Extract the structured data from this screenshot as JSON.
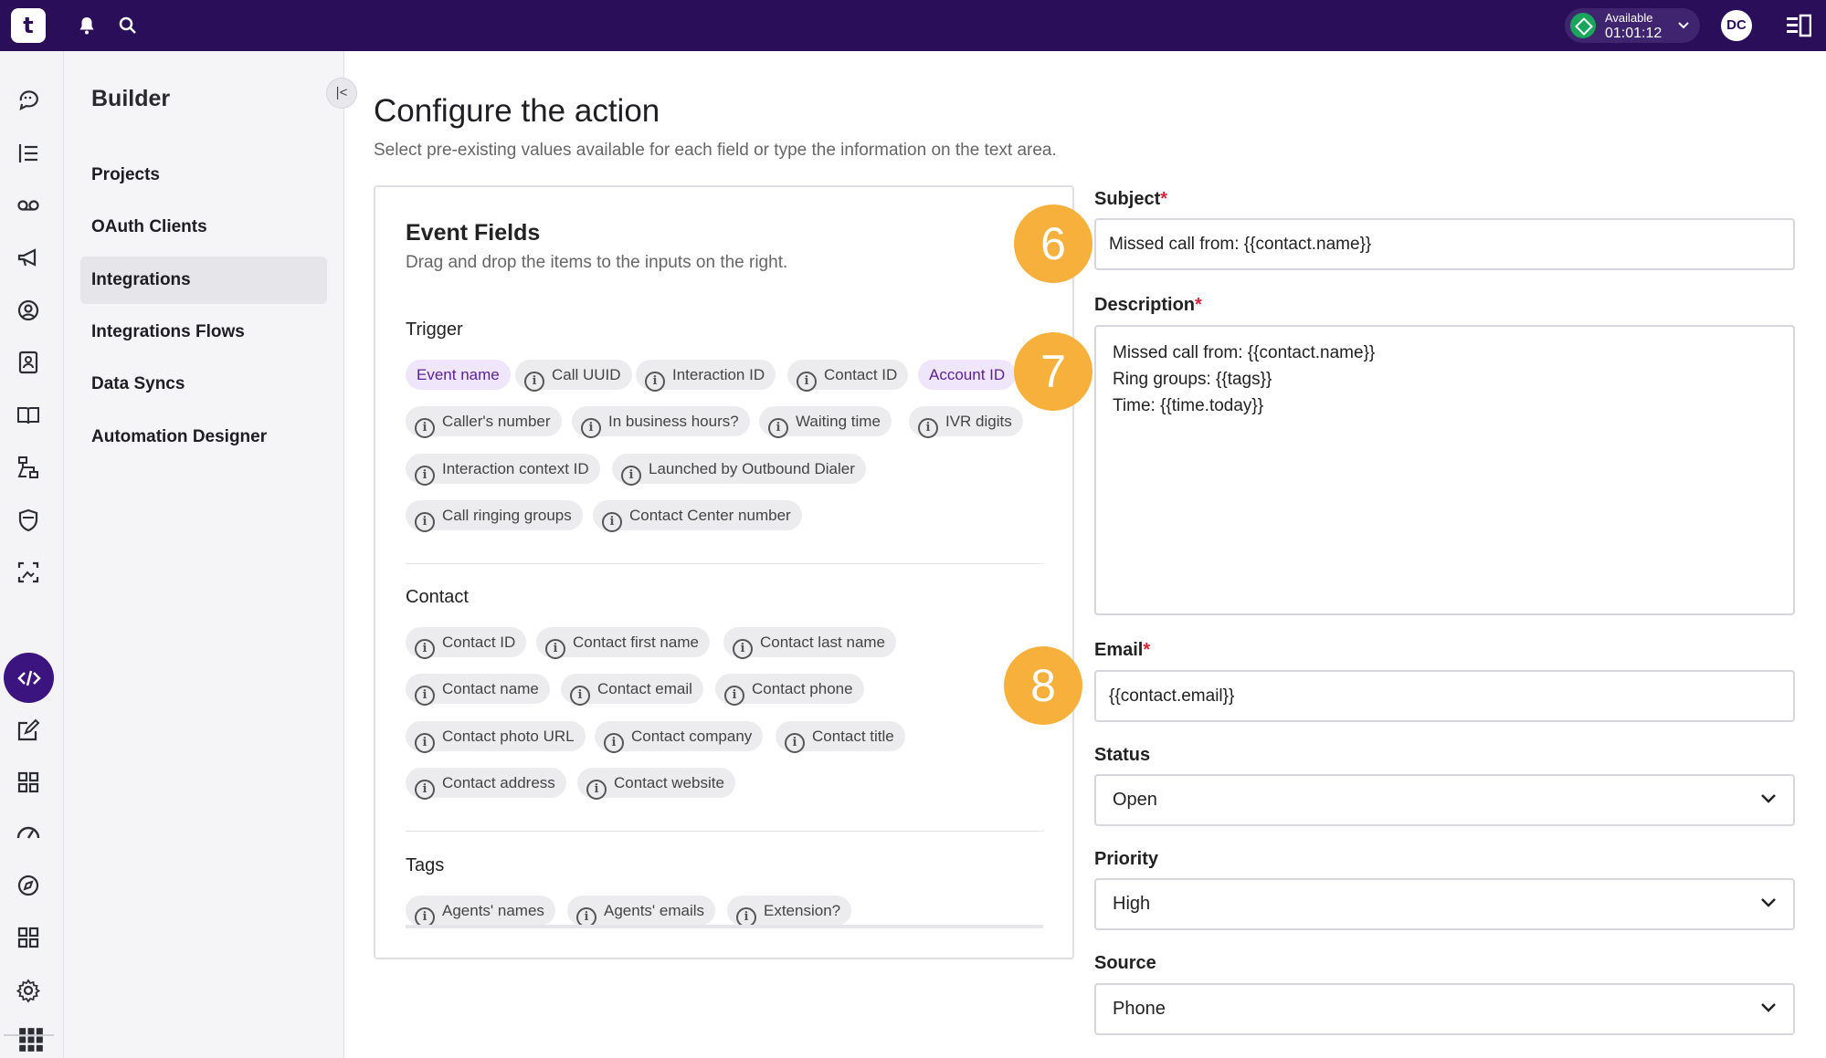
{
  "topbar": {
    "logo": "t",
    "status": {
      "label": "Available",
      "time": "01:01:12",
      "color": "#19a55b"
    },
    "avatar_initials": "DC",
    "icons": [
      "bell-icon",
      "search-icon",
      "chevron-down-icon",
      "panel-toggle-icon"
    ],
    "background": "#2b0e5a"
  },
  "rail": {
    "icons": [
      "chat-bubbles-icon",
      "list-icon",
      "voicemail-icon",
      "megaphone-icon",
      "agent-icon",
      "contacts-icon",
      "knowledge-book-icon",
      "workflow-icon",
      "shield-icon",
      "screen-capture-icon",
      "code-icon",
      "edit-icon",
      "grid-icon",
      "gauge-icon",
      "compass-icon",
      "apps-icon",
      "gear-icon",
      "app-launcher-icon"
    ],
    "active": "code-icon",
    "accent": "#3b1480"
  },
  "subnav": {
    "title": "Builder",
    "items": [
      {
        "label": "Projects"
      },
      {
        "label": "OAuth Clients"
      },
      {
        "label": "Integrations",
        "active": true
      },
      {
        "label": "Integrations Flows"
      },
      {
        "label": "Data Syncs"
      },
      {
        "label": "Automation Designer"
      }
    ]
  },
  "main": {
    "title": "Configure the action",
    "subtitle": "Select pre-existing values available for each field or type the information on the text area."
  },
  "event_fields": {
    "title": "Event Fields",
    "subtitle": "Drag and drop the items to the inputs on the right.",
    "trigger": {
      "label": "Trigger",
      "chips": [
        "Event name",
        "Call UUID",
        "Interaction ID",
        "Contact ID",
        "Account ID",
        "Caller's number",
        "In business hours?",
        "Waiting time",
        "IVR digits",
        "Interaction context ID",
        "Launched by Outbound Dialer",
        "Call ringing groups",
        "Contact Center number"
      ]
    },
    "contact": {
      "label": "Contact",
      "chips": [
        "Contact ID",
        "Contact first name",
        "Contact last name",
        "Contact name",
        "Contact email",
        "Contact phone",
        "Contact photo URL",
        "Contact company",
        "Contact title",
        "Contact address",
        "Contact website"
      ]
    },
    "tags": {
      "label": "Tags",
      "chips": [
        "Agents' names",
        "Agents' emails",
        "Extension?"
      ]
    }
  },
  "form": {
    "subject": {
      "label": "Subject",
      "required": "*",
      "value": "Missed call from: {{contact.name}}"
    },
    "description": {
      "label": "Description",
      "required": "*",
      "value": "Missed call from: {{contact.name}}\nRing groups: {{tags}}\nTime: {{time.today}}"
    },
    "email": {
      "label": "Email",
      "required": "*",
      "value": "{{contact.email}}"
    },
    "status": {
      "label": "Status",
      "value": "Open"
    },
    "priority": {
      "label": "Priority",
      "value": "High"
    },
    "source": {
      "label": "Source",
      "value": "Phone"
    }
  },
  "step_badges": [
    "6",
    "7",
    "8"
  ],
  "colors": {
    "badge": "#f7b03c",
    "required": "#d8243b",
    "chip_highlight": "#efe6fb"
  }
}
